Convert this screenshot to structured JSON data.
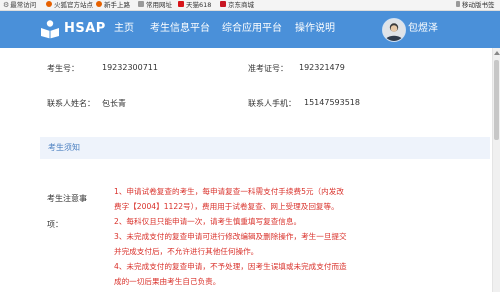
{
  "browser": {
    "bookmarks": [
      {
        "label": "最常访问",
        "icon": "gear-icon",
        "color": "#777777"
      },
      {
        "label": "火狐官方站点",
        "icon": "firefox-icon",
        "color": "#e66000"
      },
      {
        "label": "新手上路",
        "icon": "firefox-icon",
        "color": "#e66000"
      },
      {
        "label": "常用网址",
        "icon": "folder-icon",
        "color": "#9a9a9a"
      },
      {
        "label": "天猫618",
        "icon": "tmall-icon",
        "color": "#d7141a"
      },
      {
        "label": "京东商城",
        "icon": "jd-icon",
        "color": "#c81623"
      }
    ],
    "mobile_bookmarks": "移动版书签"
  },
  "header": {
    "logo": "HSAP",
    "nav": [
      "主页",
      "考生信息平台",
      "综合应用平台",
      "操作说明"
    ],
    "user_name": "包煜泽",
    "bg_color": "#4a90d9"
  },
  "info": {
    "candidate_no_label": "考生号：",
    "candidate_no": "19232300711",
    "admission_no_label": "准考证号：",
    "admission_no": "192321479",
    "contact_label": "联系人姓名：",
    "contact": "包长青",
    "contact_phone_label": "联系人手机：",
    "contact_phone": "15147593518"
  },
  "notice": {
    "title": "考生须知",
    "attention_label_1": "考生注意事",
    "attention_label_2": "项：",
    "rules": [
      "1、申请试卷复查的考生，每申请复查一科需支付手续费5元（内发改",
      "费字【2004】1122号），费用用于试卷复查、网上受理及回复等。",
      "2、每科仅且只能申请一次，请考生慎重填写复查信息。",
      "3、未完成支付的复查申请可进行修改编辑及删除操作，考生一旦提交",
      "并完成支付后，不允许进行其他任何操作。",
      "4、未完成支付的复查申请，不予处理，因考生误填或未完成支付而造",
      "成的一切后果由考生自己负责。"
    ],
    "rule_color": "#d9302a"
  }
}
